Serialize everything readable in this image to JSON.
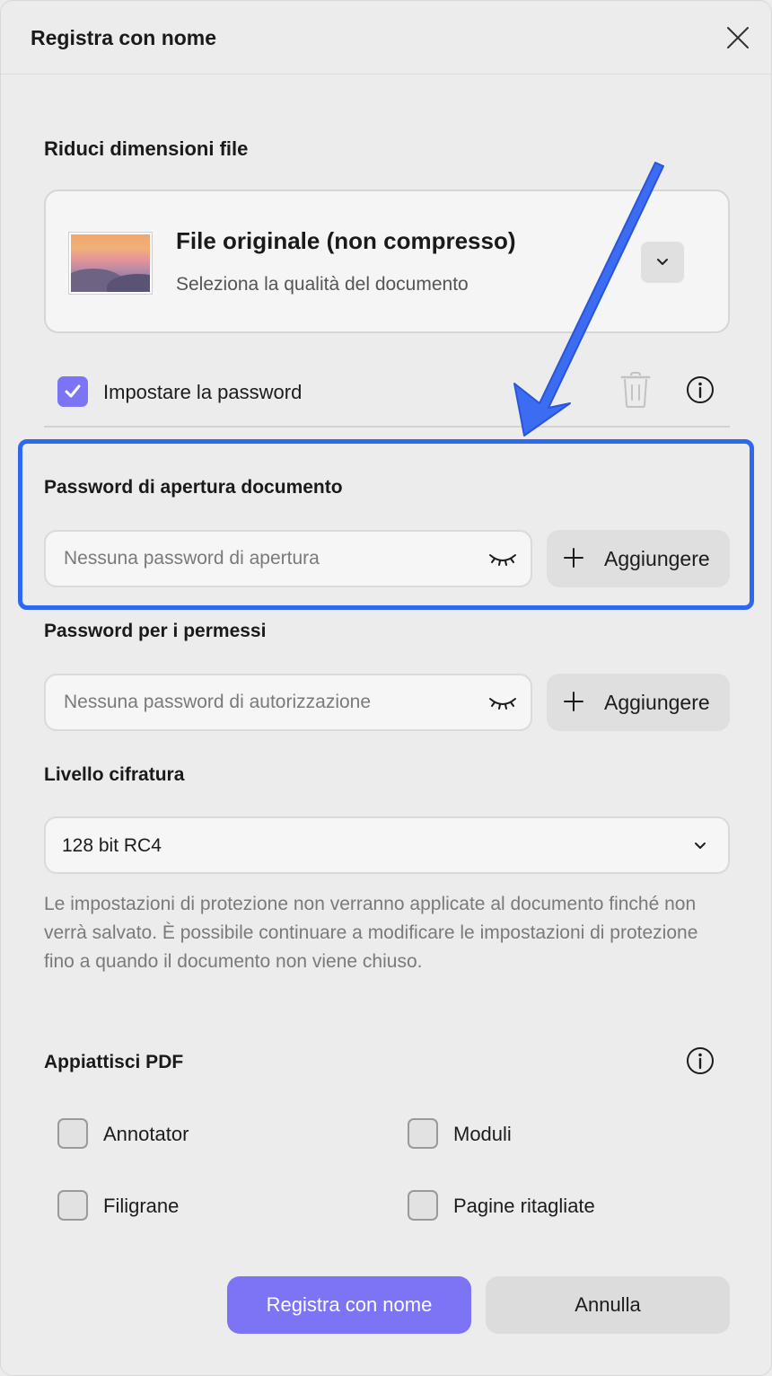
{
  "dialog": {
    "title": "Registra con nome"
  },
  "compression": {
    "section_label": "Riduci dimensioni file",
    "title": "File originale (non compresso)",
    "subtitle": "Seleziona la qualità del documento"
  },
  "password_toggle": {
    "label": "Impostare la password",
    "checked": true
  },
  "open_password": {
    "label": "Password di apertura documento",
    "placeholder": "Nessuna password di apertura",
    "value": "",
    "add_label": "Aggiungere"
  },
  "permissions_password": {
    "label": "Password per i permessi",
    "placeholder": "Nessuna password di autorizzazione",
    "value": "",
    "add_label": "Aggiungere"
  },
  "encryption": {
    "label": "Livello cifratura",
    "selected": "128 bit RC4"
  },
  "note": "Le impostazioni di protezione non verranno applicate al documento finché non verrà salvato. È possibile continuare a modificare le impostazioni di protezione fino a quando il documento non viene chiuso.",
  "flatten": {
    "label": "Appiattisci PDF",
    "options": [
      {
        "label": "Annotator",
        "checked": false
      },
      {
        "label": "Moduli",
        "checked": false
      },
      {
        "label": "Filigrane",
        "checked": false
      },
      {
        "label": "Pagine ritagliate",
        "checked": false
      }
    ]
  },
  "actions": {
    "save_label": "Registra con nome",
    "cancel_label": "Annulla"
  },
  "colors": {
    "accent": "#7d73f5",
    "highlight": "#2f68f0"
  }
}
